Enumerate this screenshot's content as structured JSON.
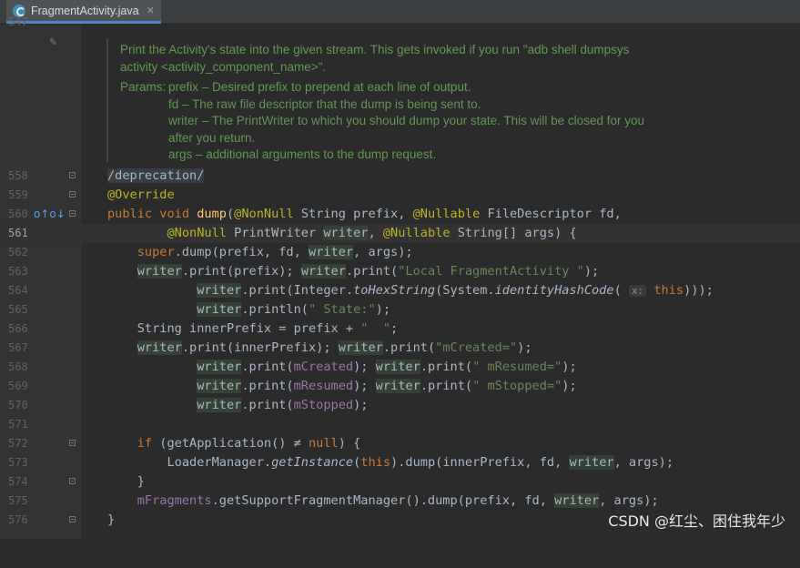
{
  "tab": {
    "title": "FragmentActivity.java",
    "close": "✕",
    "icon": "java-class-icon"
  },
  "gutter": {
    "top_partial_line": "547",
    "line_numbers": [
      "558",
      "559",
      "560",
      "561",
      "562",
      "563",
      "564",
      "565",
      "566",
      "567",
      "568",
      "569",
      "570",
      "571",
      "572",
      "573",
      "574",
      "575",
      "576"
    ],
    "active_line": "561"
  },
  "doc": {
    "line1": "Print the Activity's state into the given stream. This gets invoked if you run \"adb shell dumpsys",
    "line2": "activity <activity_component_name>\".",
    "params_label": "Params:",
    "params": [
      "prefix – Desired prefix to prepend at each line of output.",
      "fd – The raw file descriptor that the dump is being sent to.",
      "writer – The PrintWriter to which you should dump your state. This will be closed for you",
      "after you return.",
      "args – additional arguments to the dump request."
    ]
  },
  "code": {
    "l558": "/deprecation/",
    "l559": "@Override",
    "l560_kw": "public void ",
    "l560_fn": "dump",
    "l560_a1": "@NonNull",
    "l560_b": " String prefix, ",
    "l560_a2": "@Nullable",
    "l560_c": " FileDescriptor fd,",
    "l561_a1": "@NonNull",
    "l561_b": " PrintWriter ",
    "l561_w": "writer",
    "l561_c": ", ",
    "l561_a2": "@Nullable",
    "l561_d": " String[] args) {",
    "l562_kw": "super",
    "l562_b": ".dump(prefix, fd, ",
    "l562_c": ", args);",
    "l563_s": "\"Local FragmentActivity \"",
    "l564_a": ".print(Integer.",
    "l564_m": "toHexString",
    "l564_b": "(System.",
    "l564_m2": "identityHashCode",
    "l564_hint": "x:",
    "l564_kw": "this",
    "l564_c": ")));",
    "l565_s": "\" State:\"",
    "l566_a": "String innerPrefix = prefix + ",
    "l566_s": "\"  \"",
    "l567_a": ".print(innerPrefix); ",
    "l567_s": "\"mCreated=\"",
    "l568_f": "mCreated",
    "l568_s": "\" mResumed=\"",
    "l569_f": "mResumed",
    "l569_s": "\" mStopped=\"",
    "l570_f": "mStopped",
    "l572_kw": "if",
    "l572_a": " (getApplication() ≠ ",
    "l572_kw2": "null",
    "l572_b": ") {",
    "l573_a": "LoaderManager.",
    "l573_m": "getInstance",
    "l573_kw": "this",
    "l573_b": ").dump(innerPrefix, fd, ",
    "l575_f": "mFragments",
    "l575_a": ".getSupportFragmentManager().dump(prefix, fd, ",
    "l576": "}",
    "writer": "writer",
    "print": ".print(",
    "println": ".println(",
    "close_paren": ");",
    "prefix_call": ".print(prefix); ",
    "args_end": ", args);",
    "close_brace": "}"
  },
  "watermark": "CSDN @红尘、困住我年少"
}
